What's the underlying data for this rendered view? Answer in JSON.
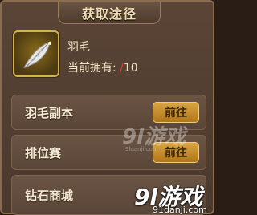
{
  "dialog": {
    "title": "获取途径"
  },
  "item": {
    "icon": "feather-icon",
    "name": "羽毛",
    "owned_label": "当前拥有:",
    "owned_current": "",
    "owned_sep": "/",
    "owned_total": "10"
  },
  "sources": [
    {
      "label": "羽毛副本",
      "button": "前往"
    },
    {
      "label": "排位赛",
      "button": "前往"
    },
    {
      "label": "钻石商城",
      "button": ""
    }
  ],
  "watermarks": {
    "faint_logo": "9l游戏",
    "faint_site": "9ldanji.com",
    "corner_logo": "9l游戏",
    "corner_site": "91danji.com"
  },
  "colors": {
    "accent_gold": "#d9a543",
    "owned_current_red": "#e23b2b"
  }
}
